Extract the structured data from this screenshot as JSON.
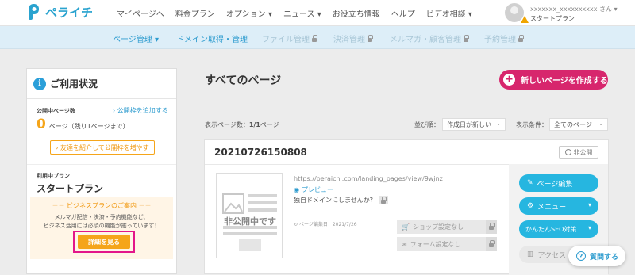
{
  "header": {
    "logo_text": "ペライチ",
    "nav": [
      {
        "label": "マイページへ"
      },
      {
        "label": "料金プラン"
      },
      {
        "label": "オプション ▾"
      },
      {
        "label": "ニュース ▾"
      },
      {
        "label": "お役立ち情報"
      },
      {
        "label": "ヘルプ"
      },
      {
        "label": "ビデオ相談 ▾"
      }
    ],
    "user": {
      "name": "xxxxxxx_xxxxxxxxxx さん ▾",
      "plan": "スタートプラン"
    }
  },
  "subnav": [
    {
      "label": "ページ管理 ▾",
      "enabled": true
    },
    {
      "label": "ドメイン取得・管理",
      "enabled": true
    },
    {
      "label": "ファイル管理",
      "enabled": false
    },
    {
      "label": "決済管理",
      "enabled": false
    },
    {
      "label": "メルマガ・顧客管理",
      "enabled": false
    },
    {
      "label": "予約管理",
      "enabled": false
    }
  ],
  "sidebar": {
    "title": "ご利用状況",
    "published_label": "公開中ページ数",
    "add_link": "› 公開枠を追加する",
    "count": "0",
    "count_suffix": "ページ（残り1ページまで）",
    "invite_button": "› 友達を紹介して公開枠を増やす",
    "plan_label": "利用中プラン",
    "plan_name": "スタートプラン",
    "promo_title": "ビジネスプランのご案内",
    "promo_text1": "メルマガ配信・決済・予約機能など、",
    "promo_text2": "ビジネス活用には必須の機能が揃っています！",
    "details_button": "詳細を見る"
  },
  "main": {
    "title": "すべてのページ",
    "create_button": "新しいページを作成する",
    "count_label": "表示ページ数：",
    "count_value": "1/1",
    "count_unit": "ページ",
    "sort_label": "並び順：",
    "sort_value": "作成日が新しい",
    "filter_label": "表示条件：",
    "filter_value": "全てのページ"
  },
  "page_card": {
    "title": "20210726150808",
    "status": "非公開",
    "thumb_label": "非公開中です",
    "url": "https://peraichi.com/landing_pages/view/9wjnz",
    "preview": "プレビュー",
    "domain_prompt": "独自ドメインにしませんか？",
    "edited": "ページ編集日：2021/7/26",
    "shop": "ショップ設定なし",
    "form": "フォーム設定なし",
    "btn_edit": "ページ編集",
    "btn_menu": "メニュー",
    "btn_seo": "かんたんSEO対策",
    "btn_access": "アクセス"
  },
  "help_button": "質問する",
  "colors": {
    "brand": "#2aa3cf",
    "accent": "#d7266d",
    "cta": "#f5a51a",
    "action": "#26b6e0"
  }
}
